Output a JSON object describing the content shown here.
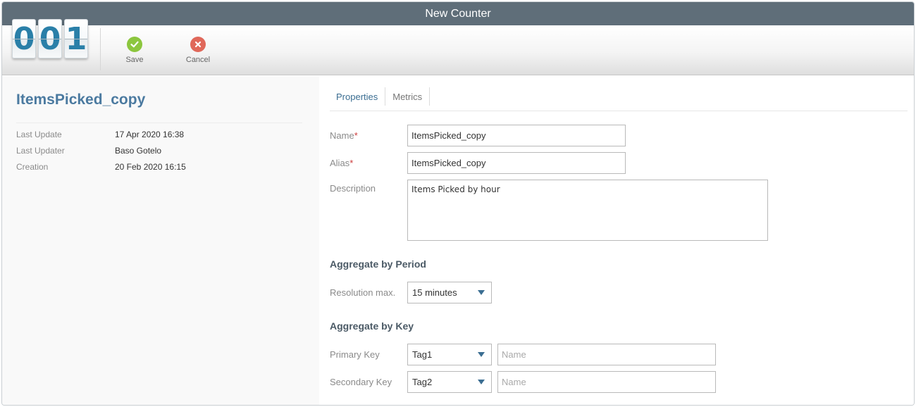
{
  "window": {
    "title": "New Counter"
  },
  "logo": {
    "digits": [
      "0",
      "0",
      "1"
    ]
  },
  "toolbar": {
    "save_label": "Save",
    "cancel_label": "Cancel"
  },
  "item": {
    "name": "ItemsPicked_copy",
    "meta": [
      {
        "key": "Last Update",
        "value": "17 Apr 2020 16:38"
      },
      {
        "key": "Last Updater",
        "value": "Baso Gotelo"
      },
      {
        "key": "Creation",
        "value": "20 Feb 2020 16:15"
      }
    ]
  },
  "tabs": [
    {
      "label": "Properties",
      "active": true
    },
    {
      "label": "Metrics",
      "active": false
    }
  ],
  "form": {
    "name_label": "Name",
    "name_value": "ItemsPicked_copy",
    "alias_label": "Alias",
    "alias_value": "ItemsPicked_copy",
    "required_mark": "*",
    "description_label": "Description",
    "description_value": "Items Picked by hour",
    "aggregate_period_title": "Aggregate by Period",
    "resolution_label": "Resolution max.",
    "resolution_value": "15 minutes",
    "aggregate_key_title": "Aggregate by Key",
    "primary_key_label": "Primary Key",
    "primary_key_value": "Tag1",
    "primary_name_placeholder": "Name",
    "secondary_key_label": "Secondary Key",
    "secondary_key_value": "Tag2",
    "secondary_name_placeholder": "Name"
  },
  "colors": {
    "titlebar": "#5f6e79",
    "accent": "#4b7aa0",
    "save_icon": "#8cc63e",
    "cancel_icon": "#e0685a",
    "required": "#cc3b3b"
  },
  "icons": {
    "save": "check-circle-icon",
    "cancel": "x-circle-icon",
    "dropdown": "caret-down-icon"
  }
}
